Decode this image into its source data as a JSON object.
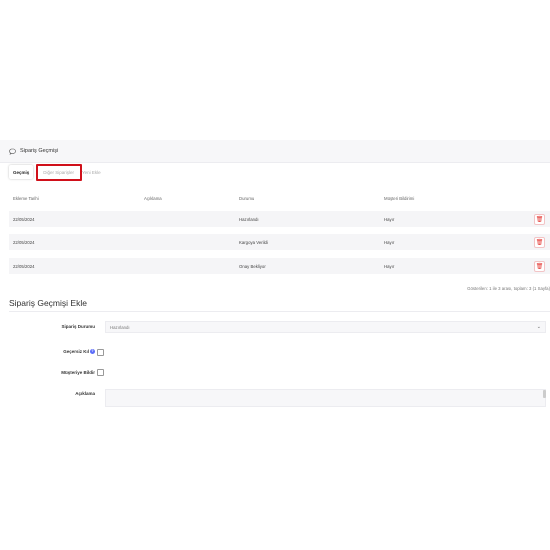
{
  "panel": {
    "title": "Sipariş Geçmişi",
    "icon": "comment-icon"
  },
  "tabs": [
    {
      "label": "Geçmiş"
    },
    {
      "label": "Diğer Siparişler"
    },
    {
      "label": "Yeni Ekle"
    }
  ],
  "table": {
    "headers": [
      "Ekleme Tarihi",
      "Açıklama",
      "Durumu",
      "Müşteri Bildirimi"
    ],
    "rows": [
      {
        "date": "22/05/2024",
        "desc": "",
        "status": "Hazırlandı",
        "notify": "Hayır"
      },
      {
        "date": "22/05/2024",
        "desc": "",
        "status": "Kargoya Verildi",
        "notify": "Hayır"
      },
      {
        "date": "22/05/2024",
        "desc": "",
        "status": "Onay Bekliyor",
        "notify": "Hayır"
      }
    ],
    "pagination": "Gösterilen: 1 ile 3 arası, toplam: 3 (1 Sayfa)"
  },
  "form": {
    "title": "Sipariş Geçmişi Ekle",
    "status_label": "Sipariş Durumu",
    "status_value": "Hazırlandı",
    "override_label": "Geçersiz Kıl",
    "notify_label": "Müşteriye Bildir",
    "comment_label": "Açıklama"
  },
  "colors": {
    "highlight": "#d0101a",
    "delete": "#e3342f"
  }
}
